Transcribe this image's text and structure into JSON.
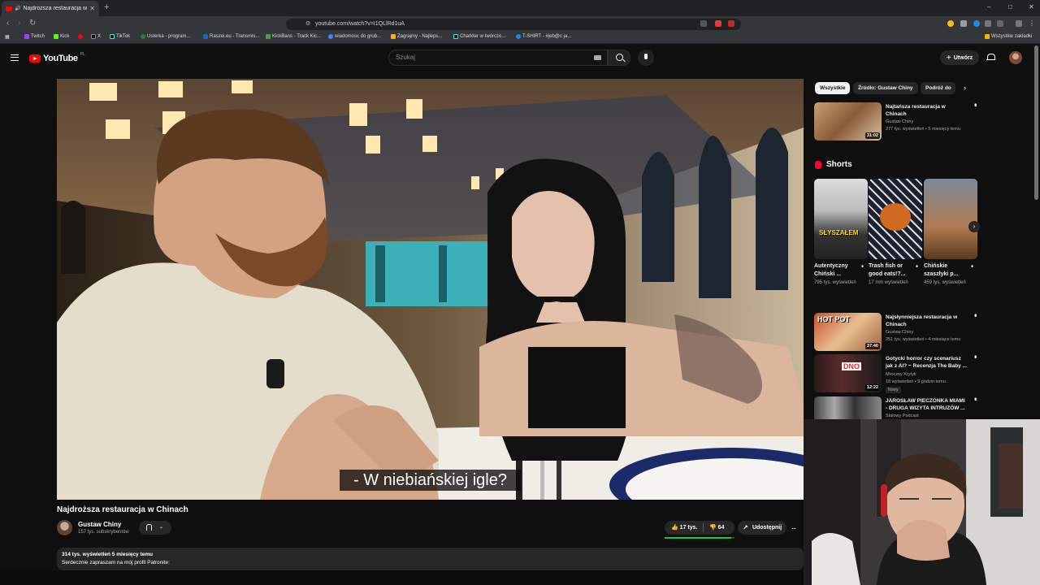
{
  "browser": {
    "tab_title": "Najdroższa restauracja w Chinach",
    "url": "youtube.com/watch?v=I1QLlRd1uA",
    "bookmarks": [
      "Twitch",
      "Kick",
      "X",
      "TikTok",
      "Usterka - program...",
      "Raszei.eu - Transmis...",
      "KickBans - Track Kic...",
      "wiadomosc do grub...",
      "Zagrajmy - Najleps...",
      "Charkter w twórczo...",
      "T-SHIRT - #jeb@c ja..."
    ],
    "all_bookmarks": "Wszystkie zakładki"
  },
  "header": {
    "logo": "YouTube",
    "logo_region": "PL",
    "search_placeholder": "Szukaj",
    "create_label": "Utwórz",
    "icons": [
      "menu-icon",
      "search-icon",
      "mic-icon",
      "bell-icon"
    ]
  },
  "video": {
    "subtitle": "- W niebiańskiej igle?",
    "title": "Najdroższa restauracja w Chinach",
    "channel": "Gustaw Chiny",
    "subscribers": "157 tys. subskrybentów",
    "likes": "17 tys.",
    "like_ratio": 0.95,
    "dislikes": "64",
    "share_label": "Udostępnij",
    "more": "...",
    "views_date": "314 tys. wyświetleń  5 miesięcy temu",
    "description": "Serdecznie zapraszam na mój profil Patronite:"
  },
  "sidebar": {
    "chips": [
      "Wszystkie",
      "Źródło: Gustaw Chiny",
      "Podróż do"
    ],
    "shorts_title": "Shorts",
    "recs_top": [
      {
        "title": "Najtańsza restauracja w Chinach",
        "channel": "Gustaw Chiny",
        "meta": "277 tys. wyświetleń • 5 miesięcy temu",
        "duration": "31:02"
      }
    ],
    "shorts": [
      {
        "title": "Autentyczny Chiński ...",
        "views": "795 tys. wyświetleń",
        "overlay": "SŁYSZAŁEM"
      },
      {
        "title": "Trash fish or good eats!?...",
        "views": "17 mln wyświetleń"
      },
      {
        "title": "Chińskie szaszłyki p...",
        "views": "459 tys. wyświetleń"
      }
    ],
    "recs": [
      {
        "title": "Najsłynniejsza restauracja w Chinach",
        "channel": "Gustaw Chiny",
        "meta": "251 tys. wyświetleń • 4 miesiące temu",
        "duration": "37:40",
        "overlay": "HOT POT"
      },
      {
        "title": "Gotycki horror czy scenariusz jak z AI? ~ Recenzja The Baby ...",
        "channel": "Mroczny Krytyk",
        "meta": "18 wyświetleń • 9 godzin temu",
        "duration": "12:22",
        "badge": "Nowy",
        "overlay": "DNO"
      },
      {
        "title": "JAROSŁAW PIECZONKA MIAMI - DRUGA WIZYTA INTRUZÓW ...",
        "channel": "Stalowy Podcast"
      }
    ]
  }
}
